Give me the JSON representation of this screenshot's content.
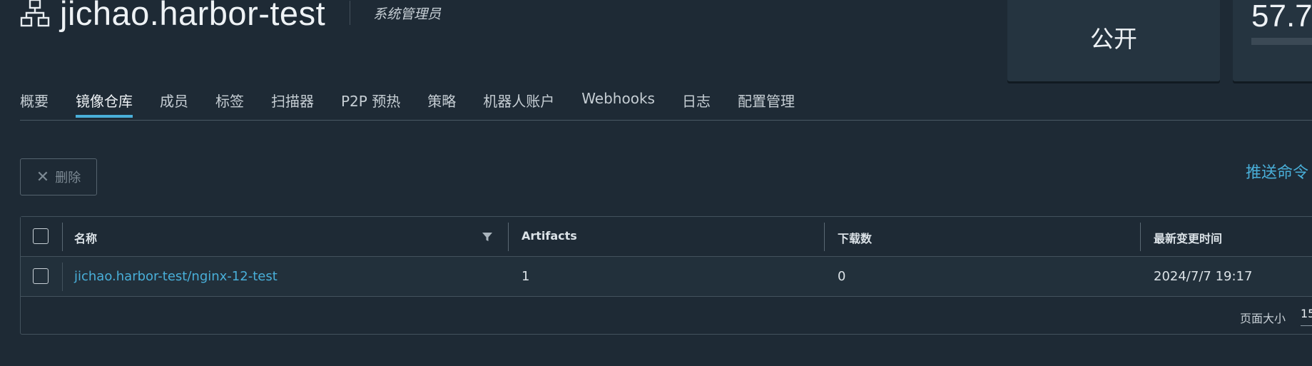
{
  "header": {
    "project_icon": "project-network-icon",
    "title": "jichao.harbor-test",
    "role": "系统管理员"
  },
  "cards": {
    "access_level": "公开",
    "quota_value": "57.7"
  },
  "tabs": [
    {
      "label": "概要",
      "active": false
    },
    {
      "label": "镜像仓库",
      "active": true
    },
    {
      "label": "成员",
      "active": false
    },
    {
      "label": "标签",
      "active": false
    },
    {
      "label": "扫描器",
      "active": false
    },
    {
      "label": "P2P 预热",
      "active": false
    },
    {
      "label": "策略",
      "active": false
    },
    {
      "label": "机器人账户",
      "active": false
    },
    {
      "label": "Webhooks",
      "active": false
    },
    {
      "label": "日志",
      "active": false
    },
    {
      "label": "配置管理",
      "active": false
    }
  ],
  "toolbar": {
    "delete_icon": "close-icon",
    "delete_label": "删除",
    "push_command_label": "推送命令"
  },
  "table": {
    "columns": [
      "名称",
      "Artifacts",
      "下载数",
      "最新变更时间"
    ],
    "filter_icon": "filter-icon",
    "rows": [
      {
        "name": "jichao.harbor-test/nginx-12-test",
        "artifacts": "1",
        "pulls": "0",
        "updated": "2024/7/7 19:17"
      }
    ],
    "footer": {
      "page_size_label": "页面大小",
      "page_size_value": "15"
    }
  },
  "colors": {
    "background": "#1e2a35",
    "accent": "#49afd9",
    "card": "#253440"
  }
}
